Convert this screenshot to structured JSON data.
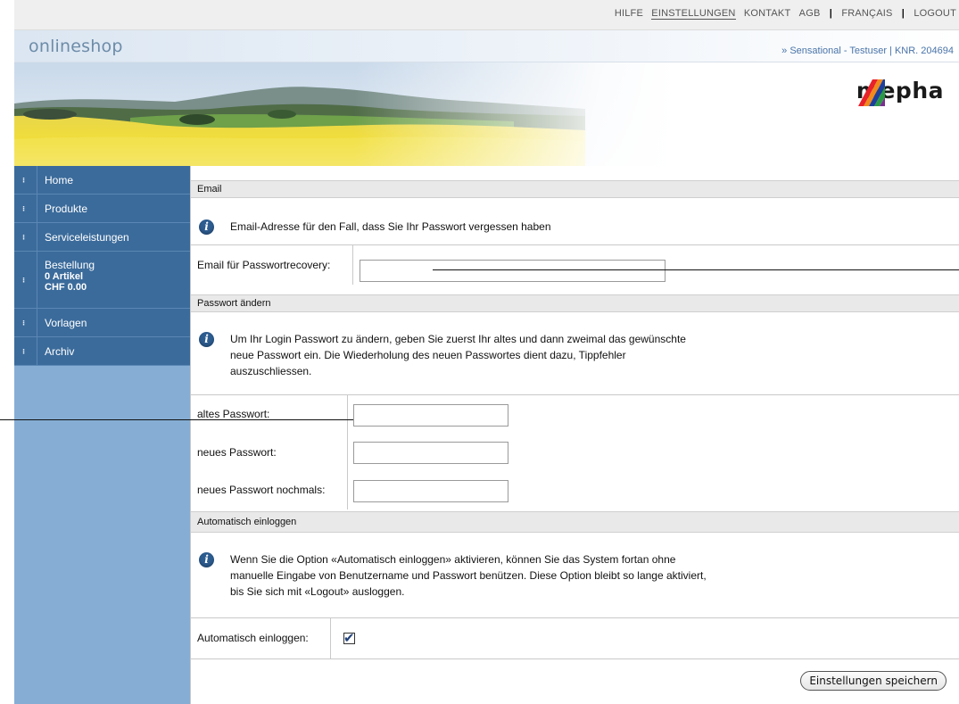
{
  "top_links": {
    "hilfe": "HILFE",
    "einstellungen": "EINSTELLUNGEN",
    "kontakt": "KONTAKT",
    "agb": "AGB",
    "francais": "FRANÇAIS",
    "logout": "LOGOUT"
  },
  "header": {
    "title": "onlineshop",
    "user_info": "» Sensational - Testuser | KNR. 204694",
    "logo_text": "mepha"
  },
  "nav": {
    "home": "Home",
    "produkte": "Produkte",
    "service": "Serviceleistungen",
    "bestellung": "Bestellung",
    "artikel": "0 Artikel",
    "total": "CHF 0.00",
    "vorlagen": "Vorlagen",
    "archiv": "Archiv"
  },
  "email_section": {
    "heading": "Email",
    "info": "Email-Adresse für den Fall, dass Sie Ihr Passwort vergessen haben",
    "label": "Email für Passwortrecovery:",
    "value": ""
  },
  "password_section": {
    "heading": "Passwort ändern",
    "info_line1": "Um Ihr Login Passwort zu ändern, geben Sie zuerst Ihr altes und dann zweimal das gewünschte",
    "info_line2": "neue Passwort ein. Die Wiederholung des neuen Passwortes dient dazu, Tippfehler",
    "info_line3": "auszuschliessen.",
    "old_label": "altes Passwort:",
    "new_label": "neues Passwort:",
    "repeat_label": "neues Passwort nochmals:"
  },
  "autologin_section": {
    "heading": "Automatisch einloggen",
    "info_line1": "Wenn Sie die Option «Automatisch einloggen» aktivieren, können Sie das System fortan ohne",
    "info_line2": "manuelle Eingabe von Benutzername und Passwort benützen. Diese Option bleibt so lange aktiviert,",
    "info_line3": "bis Sie sich mit «Logout» ausloggen.",
    "label": "Automatisch einloggen:",
    "checked": true
  },
  "save_button": "Einstellungen speichern",
  "colors": {
    "nav_bg": "#3b6b9b",
    "sidebar_bg": "#86aed5",
    "section_bg": "#e9e9e9",
    "link_blue": "#4a74a8"
  }
}
